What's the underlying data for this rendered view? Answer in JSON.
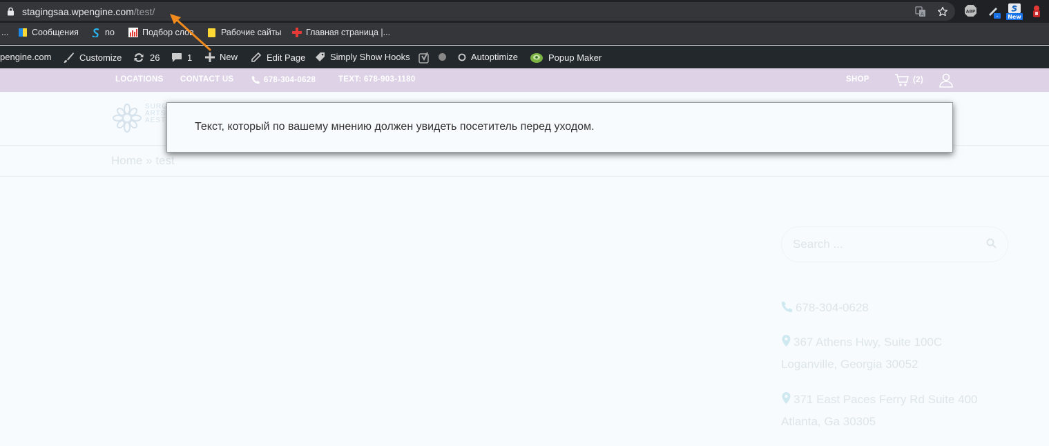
{
  "browser": {
    "url_host": "stagingsaa.wpengine.com",
    "url_path": "/test/",
    "extensions": {
      "abp_label": "ABP",
      "new_badge": "New",
      "minus_badge": "-"
    }
  },
  "bookmarks": {
    "items": [
      {
        "label": "..."
      },
      {
        "label": "Сообщения"
      },
      {
        "label": "no"
      },
      {
        "label": "Подбор слов"
      },
      {
        "label": "Рабочие сайты"
      },
      {
        "label": "Главная страница |..."
      }
    ]
  },
  "adminbar": {
    "site": "pengine.com",
    "customize": "Customize",
    "updates_count": "26",
    "comments_count": "1",
    "new": "New",
    "edit_page": "Edit Page",
    "simply_show_hooks": "Simply Show Hooks",
    "autoptimize": "Autoptimize",
    "popup_maker": "Popup Maker"
  },
  "topbar": {
    "locations": "LOCATIONS",
    "contact_us": "CONTACT US",
    "phone": "678-304-0628",
    "text": "TEXT: 678-903-1180",
    "shop": "SHOP",
    "cart_count": "(2)"
  },
  "header": {
    "logo_lines": [
      "SURG",
      "ARTS",
      "AEST"
    ]
  },
  "breadcrumb": {
    "home": "Home",
    "separator": "»",
    "current": "test"
  },
  "popup": {
    "text": "Текст, который по вашему мнению должен увидеть посетитель перед уходом."
  },
  "sidebar": {
    "search_placeholder": "Search ...",
    "phone": "678-304-0628",
    "address1_line1": "367 Athens Hwy, Suite 100C",
    "address1_line2": "Loganville, Georgia 30052",
    "address2_line1": "371 East Paces Ferry Rd Suite 400",
    "address2_line2": "Atlanta, Ga 30305"
  },
  "colors": {
    "annotation_arrow": "#f08a1c",
    "topbar_bg": "#ddd2e6",
    "adminbar_bg": "#23282d"
  }
}
